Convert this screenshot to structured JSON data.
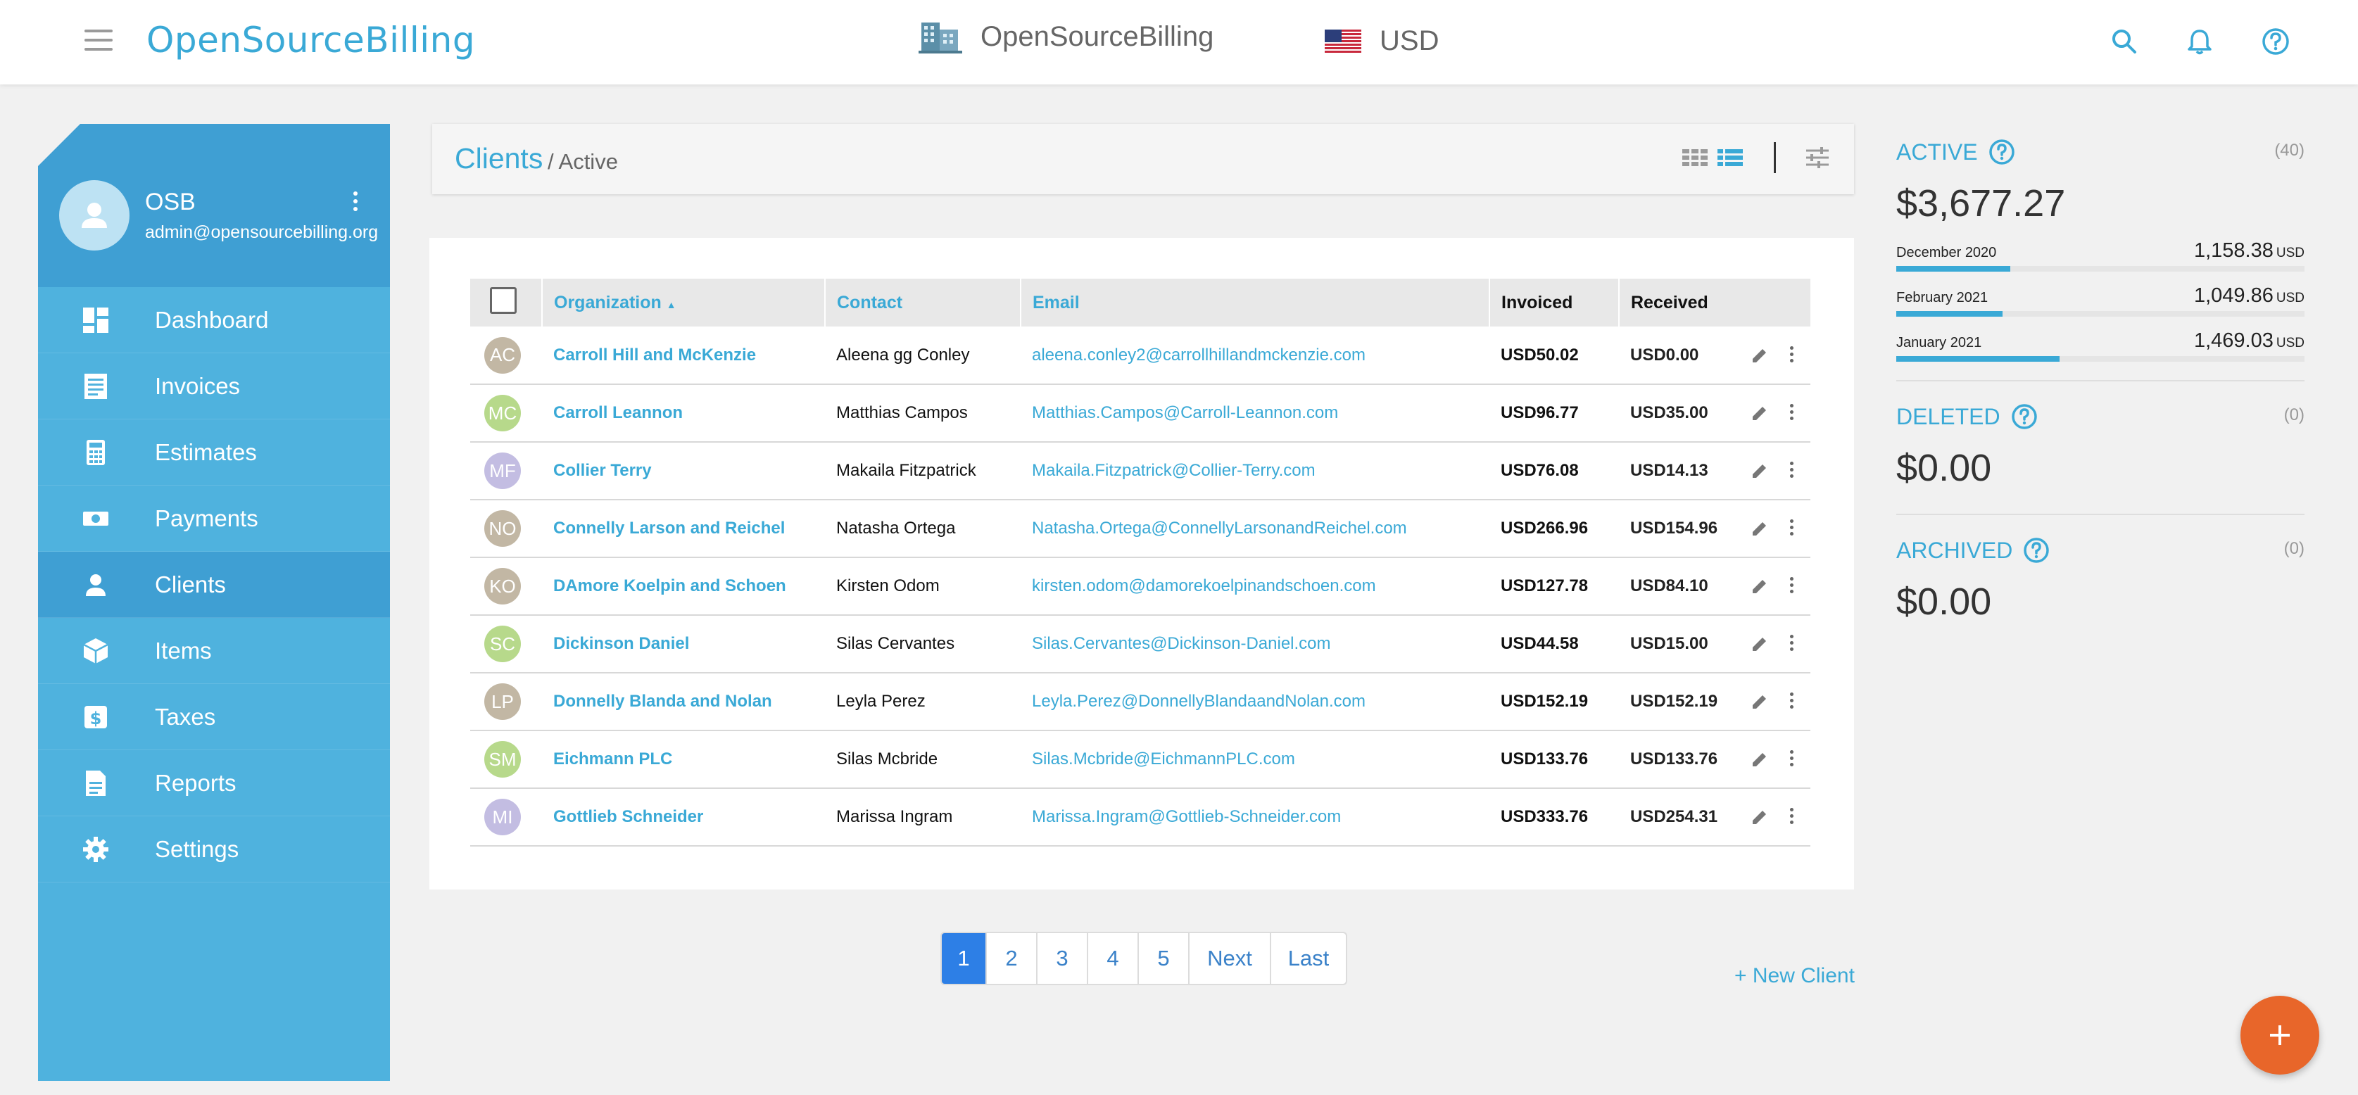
{
  "header": {
    "brand": "OpenSourceBilling",
    "company_name": "OpenSourceBilling",
    "currency": "USD",
    "icons": [
      "menu-icon",
      "building-icon",
      "us-flag-icon",
      "search-icon",
      "bell-icon",
      "help-icon"
    ]
  },
  "sidebar": {
    "user_name": "OSB",
    "user_email": "admin@opensourcebilling.org",
    "items": [
      {
        "label": "Dashboard",
        "icon": "dashboard-icon"
      },
      {
        "label": "Invoices",
        "icon": "invoice-icon"
      },
      {
        "label": "Estimates",
        "icon": "calculator-icon"
      },
      {
        "label": "Payments",
        "icon": "money-icon"
      },
      {
        "label": "Clients",
        "icon": "person-icon",
        "active": true
      },
      {
        "label": "Items",
        "icon": "box-icon"
      },
      {
        "label": "Taxes",
        "icon": "dollar-icon"
      },
      {
        "label": "Reports",
        "icon": "report-icon"
      },
      {
        "label": "Settings",
        "icon": "gear-icon"
      }
    ]
  },
  "page": {
    "title": "Clients",
    "subtitle": "/ Active"
  },
  "table": {
    "columns": {
      "organization": "Organization",
      "contact": "Contact",
      "email": "Email",
      "invoiced": "Invoiced",
      "received": "Received"
    },
    "sort_indicator": "▲",
    "rows": [
      {
        "initials": "AC",
        "avatar_color": "#c2b7a4",
        "org": "Carroll Hill and McKenzie",
        "contact": "Aleena gg Conley",
        "email": "aleena.conley2@carrollhillandmckenzie.com",
        "invoiced": "USD50.02",
        "received": "USD0.00"
      },
      {
        "initials": "MC",
        "avatar_color": "#b7d98b",
        "org": "Carroll Leannon",
        "contact": "Matthias Campos",
        "email": "Matthias.Campos@Carroll-Leannon.com",
        "invoiced": "USD96.77",
        "received": "USD35.00"
      },
      {
        "initials": "MF",
        "avatar_color": "#c3bde2",
        "org": "Collier Terry",
        "contact": "Makaila Fitzpatrick",
        "email": "Makaila.Fitzpatrick@Collier-Terry.com",
        "invoiced": "USD76.08",
        "received": "USD14.13"
      },
      {
        "initials": "NO",
        "avatar_color": "#c2b7a4",
        "org": "Connelly Larson and Reichel",
        "contact": "Natasha Ortega",
        "email": "Natasha.Ortega@ConnellyLarsonandReichel.com",
        "invoiced": "USD266.96",
        "received": "USD154.96"
      },
      {
        "initials": "KO",
        "avatar_color": "#c2b7a4",
        "org": "DAmore Koelpin and Schoen",
        "contact": "Kirsten Odom",
        "email": "kirsten.odom@damorekoelpinandschoen.com",
        "invoiced": "USD127.78",
        "received": "USD84.10"
      },
      {
        "initials": "SC",
        "avatar_color": "#b7d98b",
        "org": "Dickinson Daniel",
        "contact": "Silas Cervantes",
        "email": "Silas.Cervantes@Dickinson-Daniel.com",
        "invoiced": "USD44.58",
        "received": "USD15.00"
      },
      {
        "initials": "LP",
        "avatar_color": "#c2b7a4",
        "org": "Donnelly Blanda and Nolan",
        "contact": "Leyla Perez",
        "email": "Leyla.Perez@DonnellyBlandaandNolan.com",
        "invoiced": "USD152.19",
        "received": "USD152.19"
      },
      {
        "initials": "SM",
        "avatar_color": "#b7d98b",
        "org": "Eichmann PLC",
        "contact": "Silas Mcbride",
        "email": "Silas.Mcbride@EichmannPLC.com",
        "invoiced": "USD133.76",
        "received": "USD133.76"
      },
      {
        "initials": "MI",
        "avatar_color": "#c3bde2",
        "org": "Gottlieb Schneider",
        "contact": "Marissa Ingram",
        "email": "Marissa.Ingram@Gottlieb-Schneider.com",
        "invoiced": "USD333.76",
        "received": "USD254.31"
      }
    ]
  },
  "pagination": {
    "pages": [
      "1",
      "2",
      "3",
      "4",
      "5",
      "Next",
      "Last"
    ],
    "current": "1"
  },
  "new_client_label": "+ New Client",
  "summary": {
    "active": {
      "label": "ACTIVE",
      "count": "(40)",
      "amount": "$3,677.27",
      "breakdown": [
        {
          "month": "December 2020",
          "value": "1,158.38",
          "unit": "USD",
          "fill_pct": 28
        },
        {
          "month": "February 2021",
          "value": "1,049.86",
          "unit": "USD",
          "fill_pct": 26
        },
        {
          "month": "January 2021",
          "value": "1,469.03",
          "unit": "USD",
          "fill_pct": 40
        }
      ]
    },
    "deleted": {
      "label": "DELETED",
      "count": "(0)",
      "amount": "$0.00"
    },
    "archived": {
      "label": "ARCHIVED",
      "count": "(0)",
      "amount": "$0.00"
    }
  },
  "colors": {
    "accent": "#3aa9d6",
    "sidebar": "#4fb2de",
    "sidebar_active": "#3f9fd3",
    "fab": "#e8662a",
    "pager_active": "#2d7fe6"
  }
}
